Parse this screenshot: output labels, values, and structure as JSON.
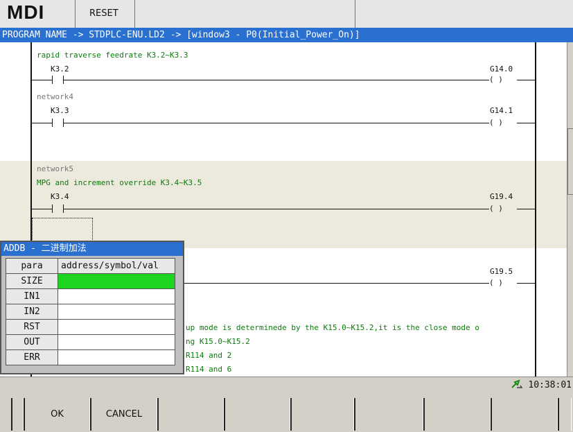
{
  "topbar": {
    "mode": "MDI",
    "reset": "RESET"
  },
  "pathbar": {
    "text": "PROGRAM NAME -> STDPLC-ENU.LD2 -> [window3 - P0(Initial_Power_On)]"
  },
  "ladder": {
    "comment1": "rapid traverse feedrate K3.2~K3.3",
    "r1_contact": "K3.2",
    "r1_coil": "G14.0",
    "network4": "network4",
    "r2_contact": "K3.3",
    "r2_coil": "G14.1",
    "network5": "network5",
    "comment2": "MPG and increment override K3.4~K3.5",
    "r3_contact": "K3.4",
    "r3_coil": "G19.4",
    "r4_coil": "G19.5",
    "line1": "up mode is determinede by the K15.0~K15.2,it is the close mode o",
    "line2": "ng K15.0~K15.2",
    "line3": "R114 and 2",
    "line4": "R114 and 6"
  },
  "coil_symbol": "(  )",
  "dialog": {
    "title": "ADDB - 二进制加法",
    "col_param": "para",
    "col_value": "address/symbol/val",
    "rows": [
      {
        "name": "SIZE",
        "value": ""
      },
      {
        "name": "IN1",
        "value": ""
      },
      {
        "name": "IN2",
        "value": ""
      },
      {
        "name": "RST",
        "value": ""
      },
      {
        "name": "OUT",
        "value": ""
      },
      {
        "name": "ERR",
        "value": ""
      }
    ],
    "selected_color": "#1ed41e"
  },
  "status": {
    "time": "10:38:01",
    "icon": "network-connection-icon"
  },
  "softkeys": {
    "ok": "OK",
    "cancel": "CANCEL"
  },
  "colors": {
    "titlebar": "#2a70d0",
    "comment": "#0d7a0d",
    "highlight": "#ece9dd"
  }
}
